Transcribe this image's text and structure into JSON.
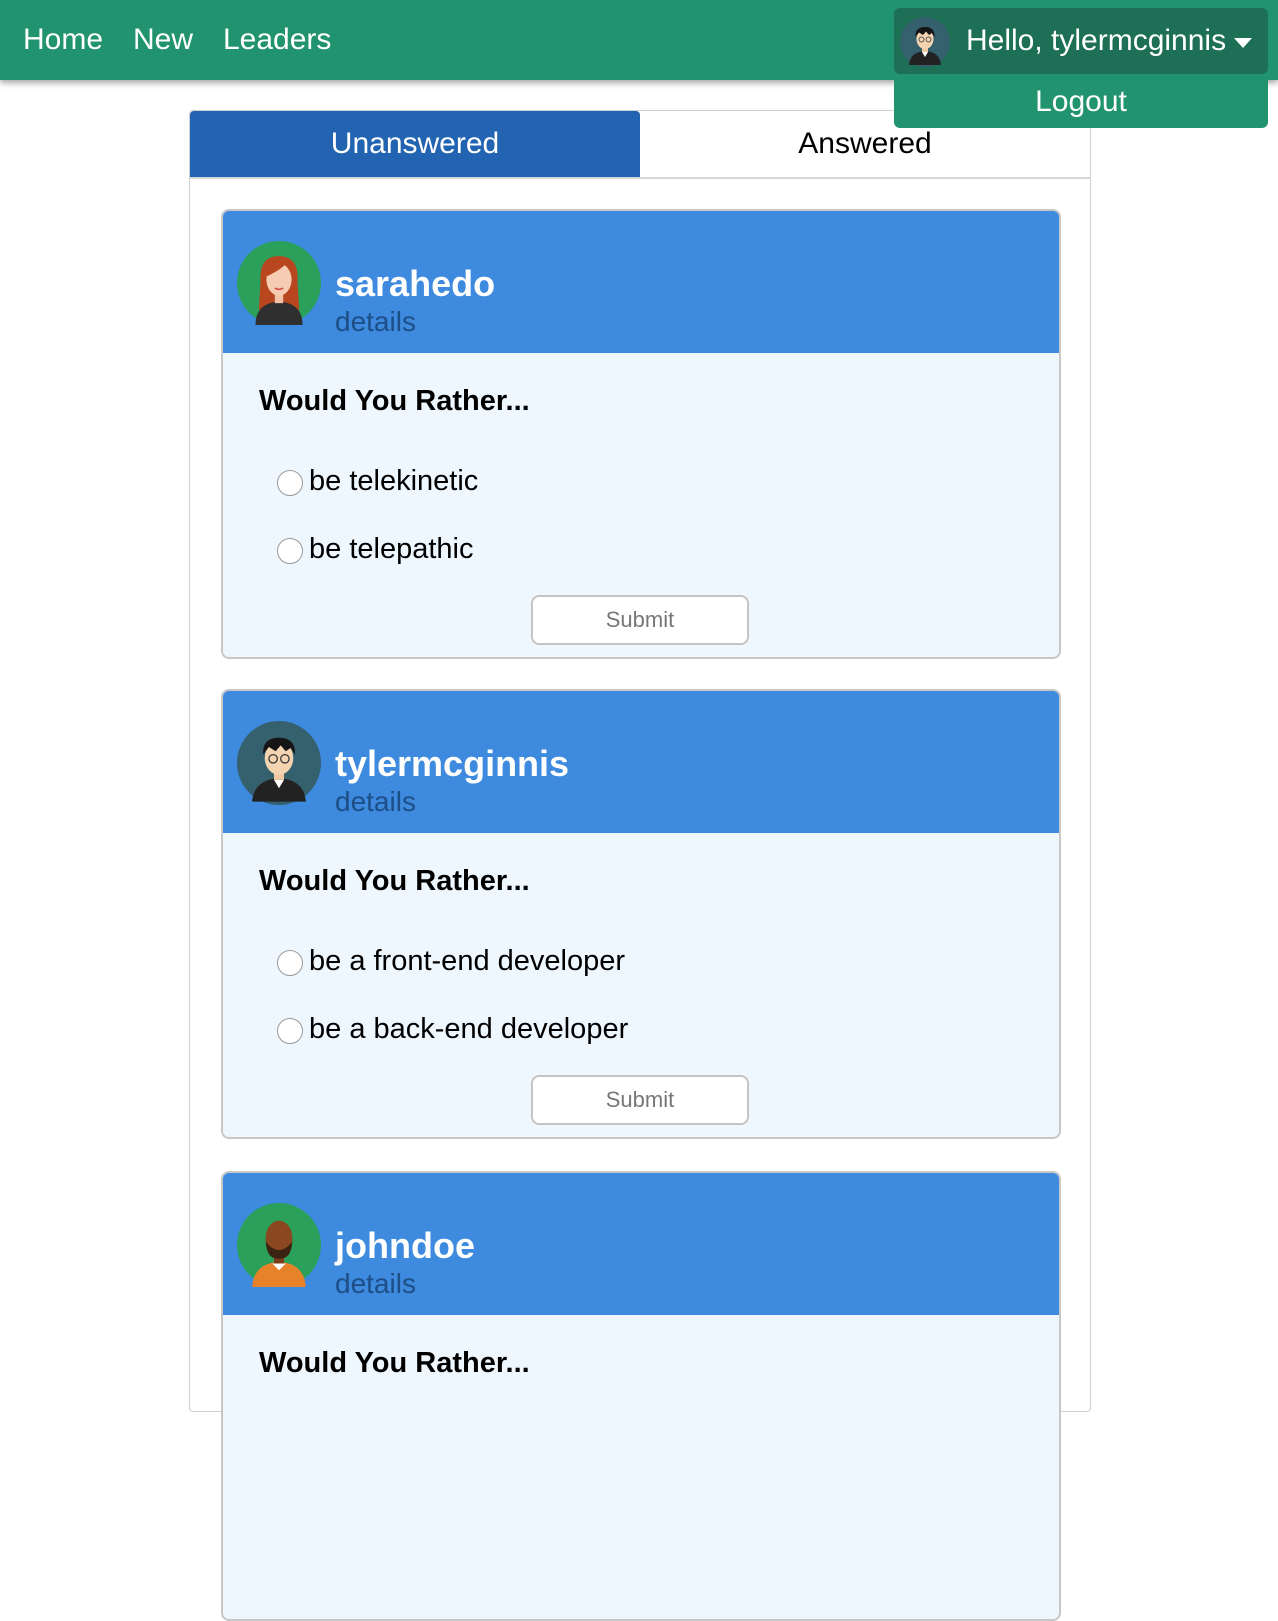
{
  "nav": {
    "links": [
      "Home",
      "New",
      "Leaders"
    ],
    "greeting": "Hello, tylermcginnis",
    "logout": "Logout"
  },
  "tabs": {
    "unanswered": "Unanswered",
    "answered": "Answered"
  },
  "questions": [
    {
      "author": "sarahedo",
      "details": "details",
      "prompt": "Would You Rather...",
      "options": [
        "be telekinetic",
        "be telepathic"
      ],
      "submit": "Submit"
    },
    {
      "author": "tylermcginnis",
      "details": "details",
      "prompt": "Would You Rather...",
      "options": [
        "be a front-end developer",
        "be a back-end developer"
      ],
      "submit": "Submit"
    },
    {
      "author": "johndoe",
      "details": "details",
      "prompt": "Would You Rather...",
      "options": [],
      "submit": ""
    }
  ],
  "colors": {
    "navbar": "#21936f",
    "active_tab": "#2264b1",
    "card_header": "#3d8ade",
    "card_body": "#eef6fe"
  }
}
